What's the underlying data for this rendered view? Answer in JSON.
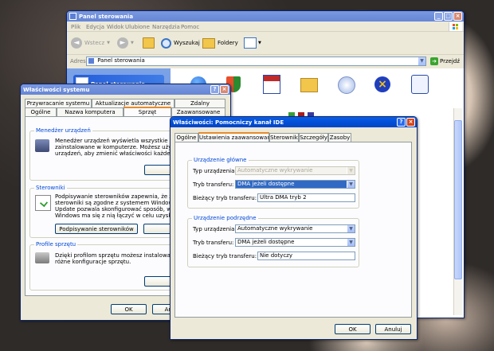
{
  "control_panel": {
    "title": "Panel sterowania",
    "menu": [
      "Plik",
      "Edycja",
      "Widok",
      "Ulubione",
      "Narzędzia",
      "Pomoc"
    ],
    "toolbar": {
      "back": "Wstecz",
      "search": "Wyszukaj",
      "folders": "Foldery"
    },
    "address_label": "Adres",
    "address_value": "Panel sterowania",
    "go_label": "Przejdź",
    "side_header": "Panel sterowania"
  },
  "system_properties": {
    "title": "Właściwości systemu",
    "tabs_row1": [
      "Przywracanie systemu",
      "Aktualizacje automatyczne",
      "Zdalny"
    ],
    "tabs_row2": [
      "Ogólne",
      "Nazwa komputera",
      "Sprzęt",
      "Zaawansowane"
    ],
    "device_manager": {
      "label": "Menedżer urządzeń",
      "lines": [
        "Menedżer urządzeń wyświetla wszystkie urz",
        "zainstalowane w komputerze. Możesz użyć M",
        "urządzeń, aby zmienić właściwości każdego"
      ],
      "button": "Meneda"
    },
    "drivers": {
      "label": "Sterowniki",
      "lines": [
        "Podpisywanie sterowników zapewnia, że zain",
        "sterowniki są zgodne z systemem Windows. W",
        "Update pozwala skonfigurować sposób, w jak",
        "Windows ma się z nią łączyć w celu uzyskan"
      ],
      "btn_signing": "Podpisywanie sterowników",
      "btn_windows": "Windo"
    },
    "profiles": {
      "label": "Profile sprzętu",
      "lines": [
        "Dzięki profilom sprzętu możesz instalować ora",
        "różne konfiguracje sprzętu."
      ],
      "button": "Profil"
    },
    "ok": "OK",
    "cancel": "Anu"
  },
  "ide_properties": {
    "title": "Właściwości: Pomocniczy kanał IDE",
    "tabs": [
      "Ogólne",
      "Ustawienia zaawansowane",
      "Sterownik",
      "Szczegóły",
      "Zasoby"
    ],
    "primary": {
      "label": "Urządzenie główne",
      "device_type_label": "Typ urządzenia:",
      "device_type_value": "Automatyczne wykrywanie",
      "transfer_mode_label": "Tryb transferu:",
      "transfer_mode_value": "DMA jeżeli dostępne",
      "current_mode_label": "Bieżący tryb transferu:",
      "current_mode_value": "Ultra DMA tryb 2"
    },
    "secondary": {
      "label": "Urządzenie podrzędne",
      "device_type_label": "Typ urządzenia:",
      "device_type_value": "Automatyczne wykrywanie",
      "transfer_mode_label": "Tryb transferu:",
      "transfer_mode_value": "DMA jeżeli dostępne",
      "current_mode_label": "Bieżący tryb transferu:",
      "current_mode_value": "Nie dotyczy"
    },
    "ok": "OK",
    "cancel": "Anuluj"
  },
  "colors": {
    "title_active": "#0350d8",
    "title_inactive": "#7b99e0",
    "group_label": "#0046d5",
    "selection": "#316ac5"
  }
}
